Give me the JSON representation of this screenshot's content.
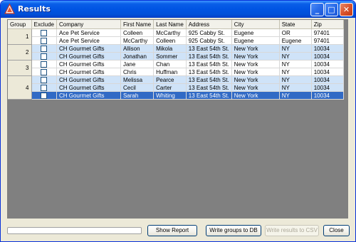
{
  "window": {
    "title": "Results",
    "minimize_glyph": "_",
    "maximize_glyph": "□",
    "close_glyph": "✕"
  },
  "grid": {
    "columns": [
      "Group",
      "Exclude",
      "Company",
      "First Name",
      "Last Name",
      "Address",
      "City",
      "State",
      "Zip"
    ],
    "groups": [
      {
        "label": "1",
        "rows": [
          {
            "company": "Ace Pet Service",
            "first": "Colleen",
            "last": "McCarthy",
            "address": "925 Cabby St.",
            "city": "Eugene",
            "state": "OR",
            "zip": "97401",
            "style": "white",
            "excluded": false
          },
          {
            "company": "Ace Pet Service",
            "first": "McCarthy",
            "last": "Colleen",
            "address": "925 Cabby St.",
            "city": "Eugene",
            "state": "Eugene",
            "zip": "97401",
            "style": "white",
            "excluded": false
          }
        ]
      },
      {
        "label": "2",
        "rows": [
          {
            "company": "CH Gourmet Gifts",
            "first": "Allison",
            "last": "Mikola",
            "address": "13 East 54th St.",
            "city": "New York",
            "state": "NY",
            "zip": "10034",
            "style": "blue",
            "excluded": false
          },
          {
            "company": "CH Gourmet Gifts",
            "first": "Jonathan",
            "last": "Sommer",
            "address": "13 East 54th St.",
            "city": "New York",
            "state": "NY",
            "zip": "10034",
            "style": "blue",
            "excluded": false
          }
        ]
      },
      {
        "label": "3",
        "rows": [
          {
            "company": "CH Gourmet Gifts",
            "first": "Jane",
            "last": "Chan",
            "address": "13 East 54th St.",
            "city": "New York",
            "state": "NY",
            "zip": "10034",
            "style": "white",
            "excluded": false
          },
          {
            "company": "CH Gourmet Gifts",
            "first": "Chris",
            "last": "Huffman",
            "address": "13 East 54th St.",
            "city": "New York",
            "state": "NY",
            "zip": "10034",
            "style": "white",
            "excluded": false
          }
        ]
      },
      {
        "label": "4",
        "rows": [
          {
            "company": "CH Gourmet Gifts",
            "first": "Melissa",
            "last": "Pearce",
            "address": "13 East 54th St.",
            "city": "New York",
            "state": "NY",
            "zip": "10034",
            "style": "blue",
            "excluded": false
          },
          {
            "company": "CH Gourmet Gifts",
            "first": "Cecil",
            "last": "Carter",
            "address": "13 East 54th St.",
            "city": "New York",
            "state": "NY",
            "zip": "10034",
            "style": "blue",
            "excluded": false
          },
          {
            "company": "CH Gourmet Gifts",
            "first": "Sarah",
            "last": "Whiting",
            "address": "13 East 54th St.",
            "city": "New York",
            "state": "NY",
            "zip": "10034",
            "style": "sel",
            "excluded": false
          }
        ]
      }
    ]
  },
  "footer": {
    "progress": 0,
    "show_report_label": "Show Report",
    "write_groups_label": "Write groups to DB",
    "write_csv_label": "Write results to CSV",
    "close_label": "Close"
  },
  "colors": {
    "titlebar": "#0054e3",
    "selection": "#316ac5",
    "group_band": "#cfe3f8",
    "empty_area": "#808080"
  }
}
